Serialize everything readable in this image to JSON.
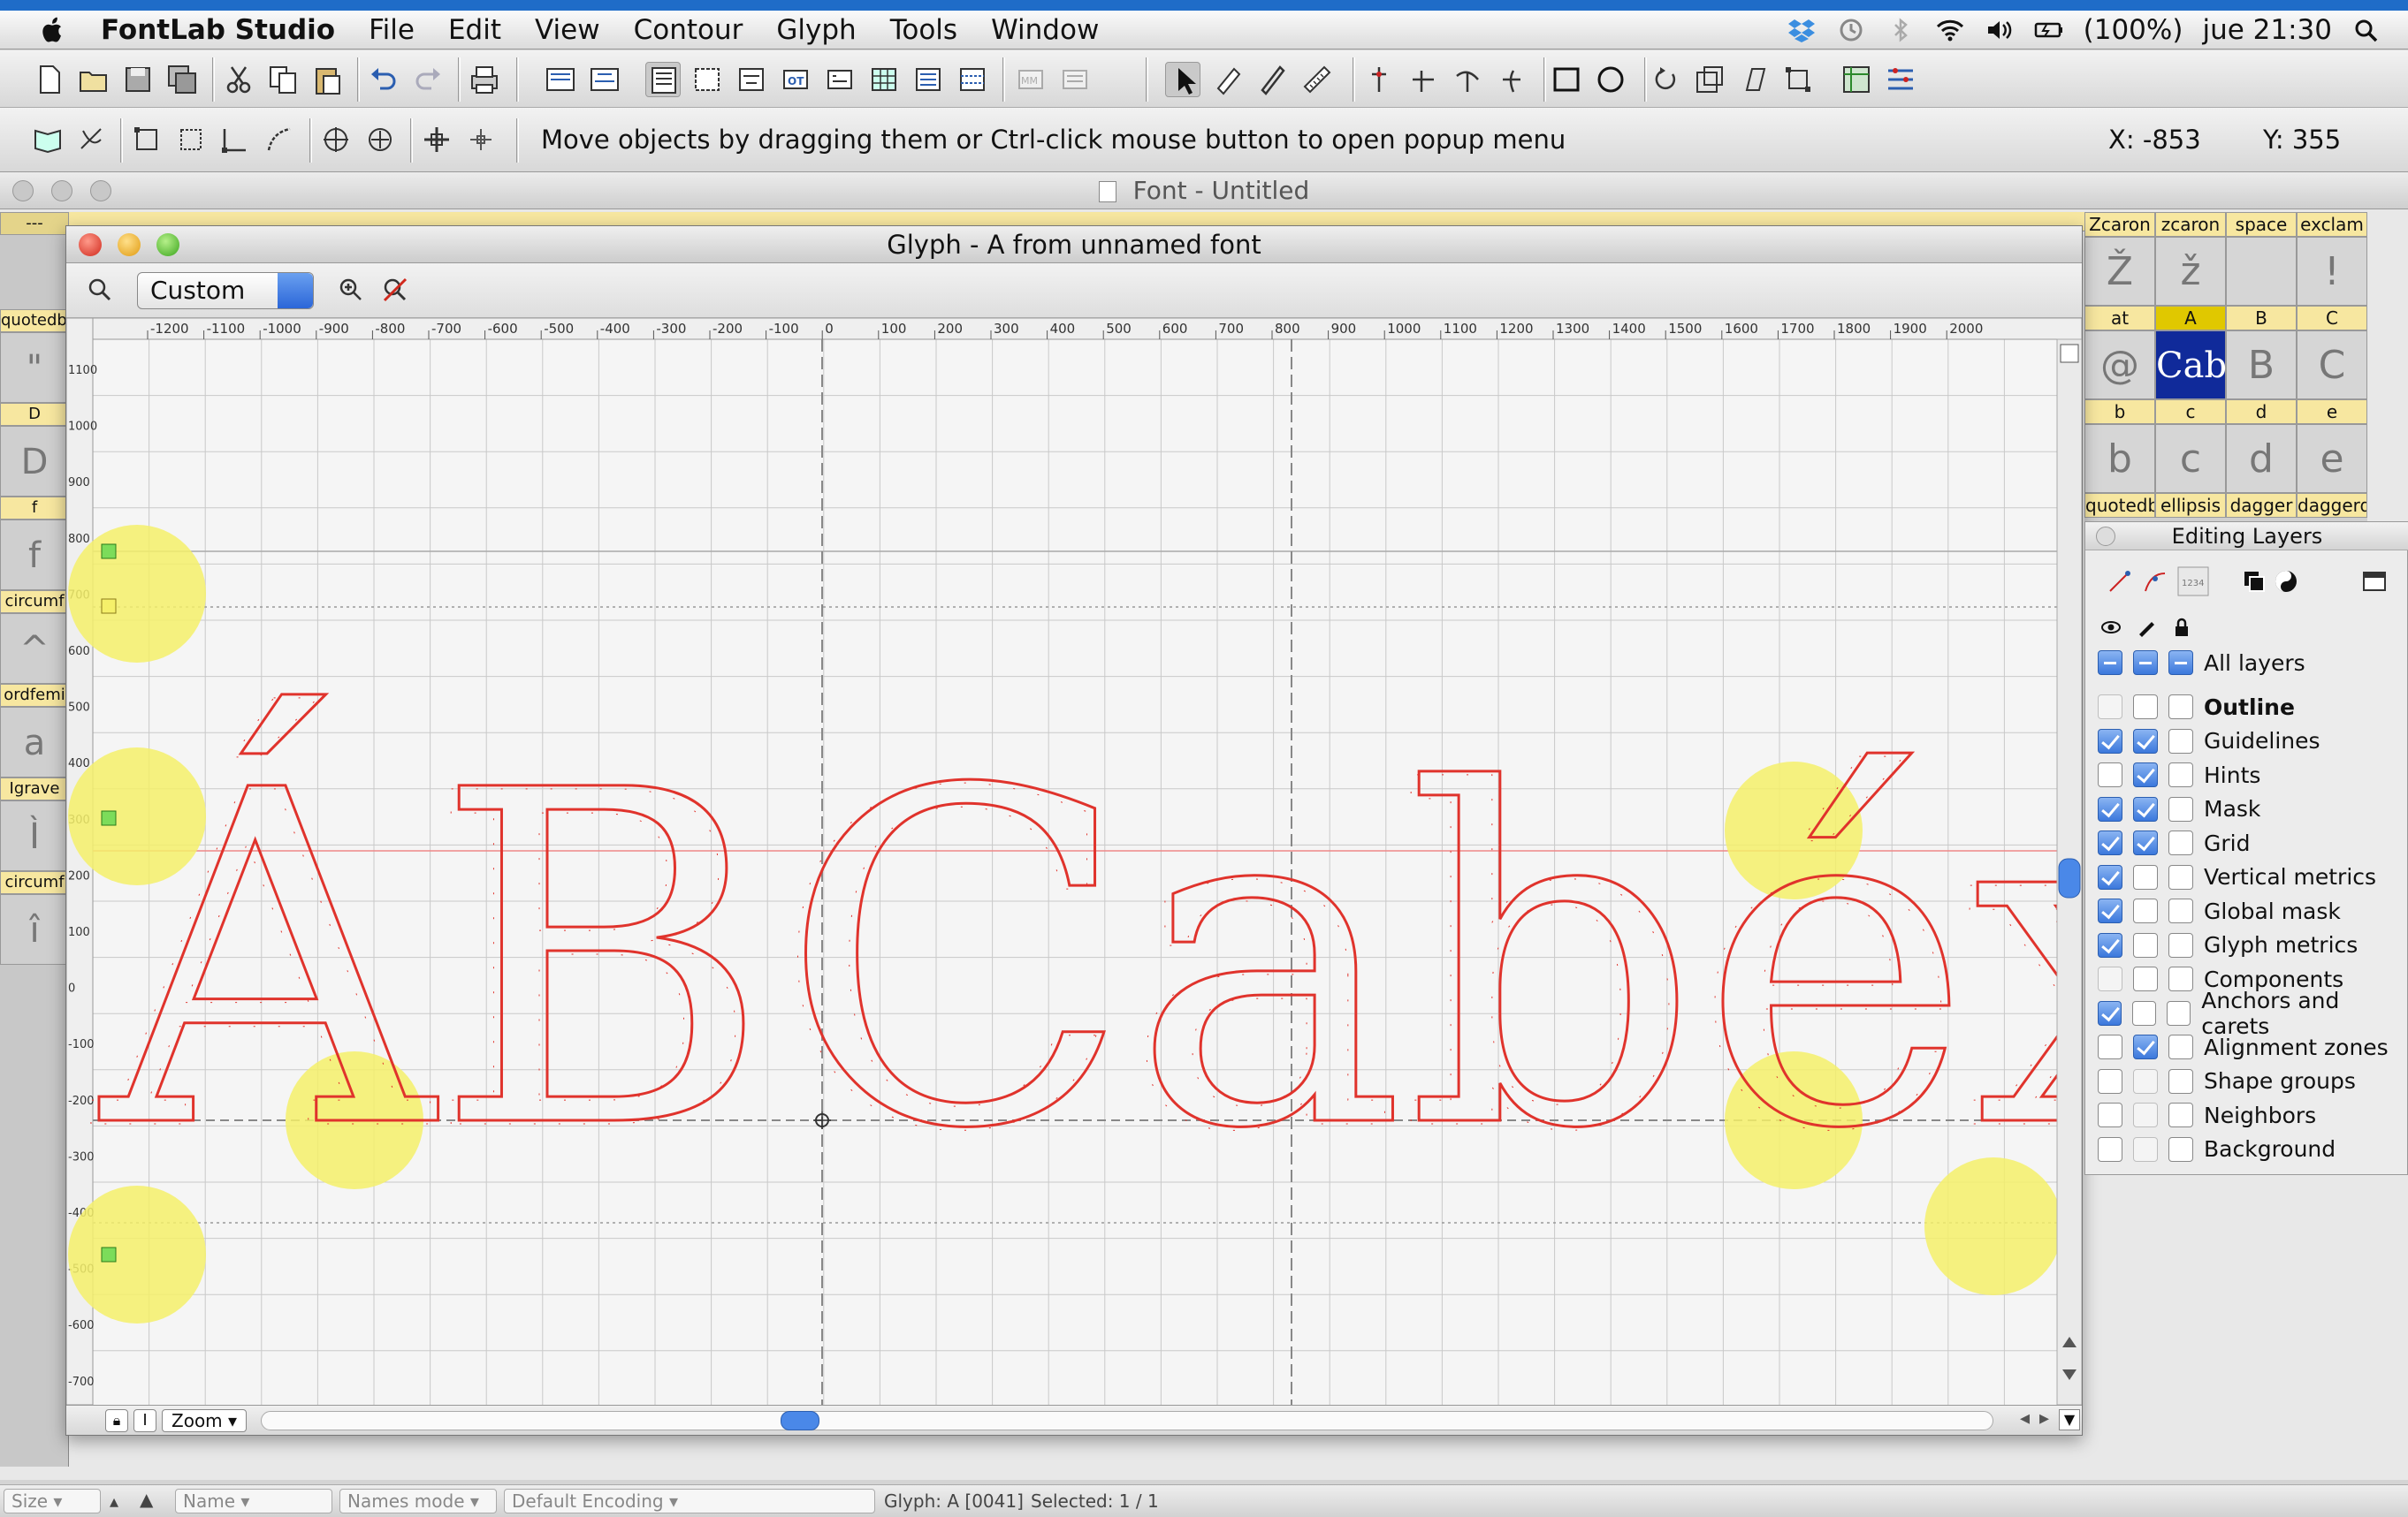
{
  "menubar": {
    "app_name": "FontLab Studio",
    "items": [
      "File",
      "Edit",
      "View",
      "Contour",
      "Glyph",
      "Tools",
      "Window"
    ],
    "battery": "(100%)",
    "clock": "jue 21:30"
  },
  "toolbar": {
    "hint": "Move objects by dragging them or Ctrl-click mouse button to open popup menu",
    "coord_x": "X: -853",
    "coord_y": "Y: 355"
  },
  "font_window": {
    "title": "Font - Untitled",
    "left_column": [
      {
        "label": "---",
        "glyph": ""
      },
      {
        "label": "quotedbl",
        "glyph": "\""
      },
      {
        "label": "D",
        "glyph": "D"
      },
      {
        "label": "f",
        "glyph": "f"
      },
      {
        "label": "circumf",
        "glyph": "^"
      },
      {
        "label": "ordfemi",
        "glyph": "a"
      },
      {
        "label": "Igrave",
        "glyph": "Ì"
      },
      {
        "label": "circumf",
        "glyph": "î"
      }
    ],
    "right_grid": [
      [
        {
          "label": "Zcaron",
          "glyph": "Ž"
        },
        {
          "label": "zcaron",
          "glyph": "ž"
        },
        {
          "label": "space",
          "glyph": ""
        },
        {
          "label": "exclam",
          "glyph": "!"
        }
      ],
      [
        {
          "label": "at",
          "glyph": "@"
        },
        {
          "label": "A",
          "glyph": "Cab",
          "selected": true
        },
        {
          "label": "B",
          "glyph": "B"
        },
        {
          "label": "C",
          "glyph": "C"
        }
      ],
      [
        {
          "label": "b",
          "glyph": "b"
        },
        {
          "label": "c",
          "glyph": "c"
        },
        {
          "label": "d",
          "glyph": "d"
        },
        {
          "label": "e",
          "glyph": "e"
        }
      ],
      [
        {
          "label": "quotedbl",
          "glyph": ""
        },
        {
          "label": "ellipsis",
          "glyph": ""
        },
        {
          "label": "dagger",
          "glyph": ""
        },
        {
          "label": "daggerdl",
          "glyph": ""
        }
      ]
    ]
  },
  "glyph_window": {
    "title": "Glyph - A from unnamed font",
    "zoom_value": "Custom",
    "bottom_zoom": "Zoom",
    "ruler_h": [
      "-1200",
      "-1100",
      "-1000",
      "-900",
      "-800",
      "-700",
      "-600",
      "-500",
      "-400",
      "-300",
      "-200",
      "-100",
      "0",
      "100",
      "200",
      "300",
      "400",
      "500",
      "600",
      "700",
      "800",
      "900",
      "1000",
      "1100",
      "1200",
      "1300",
      "1400",
      "1500",
      "1600",
      "1700",
      "1800",
      "1900",
      "2000"
    ],
    "ruler_v": [
      "1100",
      "1000",
      "900",
      "800",
      "700",
      "600",
      "500",
      "400",
      "300",
      "200",
      "100",
      "0",
      "-100",
      "-200",
      "-300",
      "-400",
      "-500",
      "-600",
      "-700"
    ],
    "text_preview": "ÁBCabéxg"
  },
  "layers_panel": {
    "title": "Editing Layers",
    "all_layers": "All layers",
    "rows": [
      {
        "label": "Outline",
        "bold": true,
        "c1": "dim",
        "c2": "off",
        "c3": "off"
      },
      {
        "label": "Guidelines",
        "c1": "on",
        "c2": "on",
        "c3": "off"
      },
      {
        "label": "Hints",
        "c1": "off",
        "c2": "on",
        "c3": "off"
      },
      {
        "label": "Mask",
        "c1": "on",
        "c2": "on",
        "c3": "off"
      },
      {
        "label": "Grid",
        "c1": "on",
        "c2": "on",
        "c3": "off"
      },
      {
        "label": "Vertical metrics",
        "c1": "on",
        "c2": "off",
        "c3": "off"
      },
      {
        "label": "Global mask",
        "c1": "on",
        "c2": "off",
        "c3": "off"
      },
      {
        "label": "Glyph metrics",
        "c1": "on",
        "c2": "off",
        "c3": "off"
      },
      {
        "label": "Components",
        "c1": "dim",
        "c2": "off",
        "c3": "off"
      },
      {
        "label": "Anchors and carets",
        "c1": "on",
        "c2": "off",
        "c3": "off"
      },
      {
        "label": "Alignment zones",
        "c1": "off",
        "c2": "on",
        "c3": "off"
      },
      {
        "label": "Shape groups",
        "c1": "off",
        "c2": "dim",
        "c3": "off"
      },
      {
        "label": "Neighbors",
        "c1": "off",
        "c2": "dim",
        "c3": "off"
      },
      {
        "label": "Background",
        "c1": "off",
        "c2": "dim",
        "c3": "off"
      }
    ]
  },
  "statusbar": {
    "size": "Size",
    "name": "Name",
    "names_mode": "Names mode",
    "encoding": "Default Encoding",
    "glyph_info": "Glyph: A [0041]",
    "selected": "Selected: 1 / 1"
  },
  "colors": {
    "outline": "#e0332c",
    "highlight": "#f5f06a",
    "selection": "#102a9a",
    "label_yellow": "#f7e7a0"
  }
}
